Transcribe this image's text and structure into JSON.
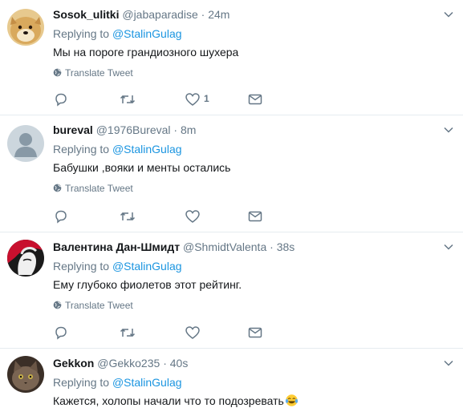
{
  "tweets": [
    {
      "name": "Sosok_ulitki",
      "handle": "@jabaparadise",
      "dot": "·",
      "time": "24m",
      "replying_prefix": "Replying to",
      "replying_to": "@StalinGulag",
      "text": "Мы на пороге грандиозного шухера",
      "translate": "Translate Tweet",
      "like_count": "1",
      "avatar": "doge-avatar"
    },
    {
      "name": "bureval",
      "handle": "@1976Bureval",
      "dot": "·",
      "time": "8m",
      "replying_prefix": "Replying to",
      "replying_to": "@StalinGulag",
      "text": "Бабушки ,вояки и менты остались",
      "translate": "Translate Tweet",
      "like_count": "",
      "avatar": "default-avatar"
    },
    {
      "name": "Валентина Дан-Шмидт",
      "handle": "@ShmidtValenta",
      "dot": "·",
      "time": "38s",
      "replying_prefix": "Replying to",
      "replying_to": "@StalinGulag",
      "text": "Ему глубоко фиолетов этот рейтинг.",
      "translate": "Translate Tweet",
      "like_count": "",
      "avatar": "portrait-avatar"
    },
    {
      "name": "Gekkon",
      "handle": "@Gekko235",
      "dot": "·",
      "time": "40s",
      "replying_prefix": "Replying to",
      "replying_to": "@StalinGulag",
      "text": "Кажется, холопы начали что то подозревать",
      "emoji": "😂",
      "avatar": "cat-avatar"
    }
  ],
  "colors": {
    "link": "#1b95e0",
    "muted": "#657786",
    "text": "#14171a",
    "divider": "#e6ecf0"
  }
}
